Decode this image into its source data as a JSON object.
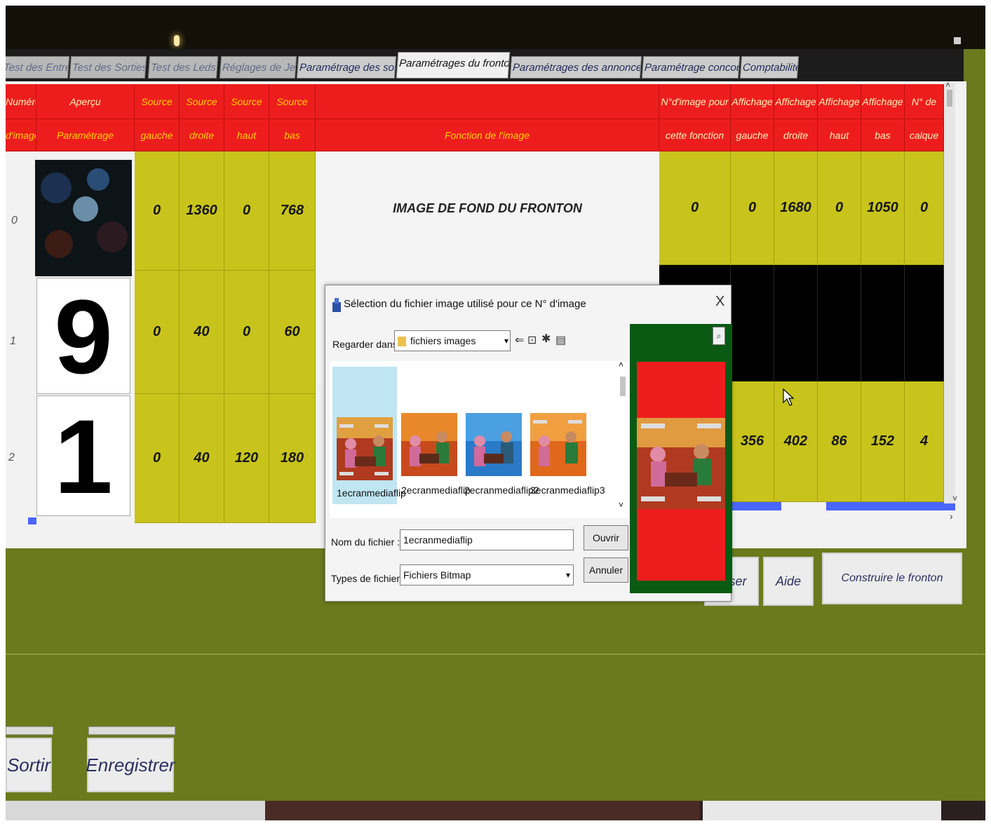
{
  "tabs": [
    {
      "label": "Test des Entrées"
    },
    {
      "label": "Test des Sorties"
    },
    {
      "label": "Test des Leds"
    },
    {
      "label": "Réglages de Jeu"
    },
    {
      "label": "Paramétrage des sons"
    },
    {
      "label": "Paramétrages du fronton"
    },
    {
      "label": "Paramétrages des annonceurs"
    },
    {
      "label": "Paramétrage concours"
    },
    {
      "label": "Comptabilité"
    }
  ],
  "table": {
    "header_top": [
      "Numéro",
      "Aperçu",
      "Source",
      "Source",
      "Source",
      "Source",
      "",
      "N°d'image pour",
      "Affichage",
      "Affichage",
      "Affichage",
      "Affichage",
      "N° de"
    ],
    "header_bottom": [
      "d'image",
      "Paramétrage",
      "gauche",
      "droite",
      "haut",
      "bas",
      "Fonction de l'image",
      "cette fonction",
      "gauche",
      "droite",
      "haut",
      "bas",
      "calque"
    ],
    "rows": [
      {
        "num": "0",
        "source": [
          "0",
          "1360",
          "0",
          "768"
        ],
        "function": "IMAGE DE FOND DU FRONTON",
        "right": [
          "0",
          "0",
          "1680",
          "0",
          "1050",
          "0"
        ]
      },
      {
        "num": "1",
        "digit": "9",
        "source": [
          "0",
          "40",
          "0",
          "60"
        ]
      },
      {
        "num": "2",
        "digit": "1",
        "source": [
          "0",
          "40",
          "120",
          "180"
        ],
        "right": [
          "356",
          "402",
          "86",
          "152",
          "4"
        ]
      }
    ]
  },
  "buttons": {
    "realiser": "aliser",
    "aide": "Aide",
    "construire": "Construire le fronton",
    "sortir": "Sortir",
    "enregistrer": "Enregistrer"
  },
  "dialog": {
    "title": "Sélection du fichier image utilisé pour ce N° d'image",
    "close": "X",
    "look_in_label": "Regarder dans :",
    "look_in_value": "fichiers images",
    "files": [
      "1ecranmediaflip",
      "2ecranmediaflip",
      "2ecranmediaflip2",
      "3ecranmediaflip3"
    ],
    "filename_label": "Nom du fichier :",
    "filename_value": "1ecranmediaflip",
    "filetype_label": "Types de fichiers :",
    "filetype_value": "Fichiers Bitmap",
    "open_button": "Ouvrir",
    "cancel_button": "Annuler"
  },
  "colors": {
    "header_red": "#ee1d1d",
    "cell_yellow": "#c8c41c",
    "background_olive": "#6b7a1c",
    "preview_green": "#0b5a14",
    "selection_blue": "#bfe6f2"
  }
}
